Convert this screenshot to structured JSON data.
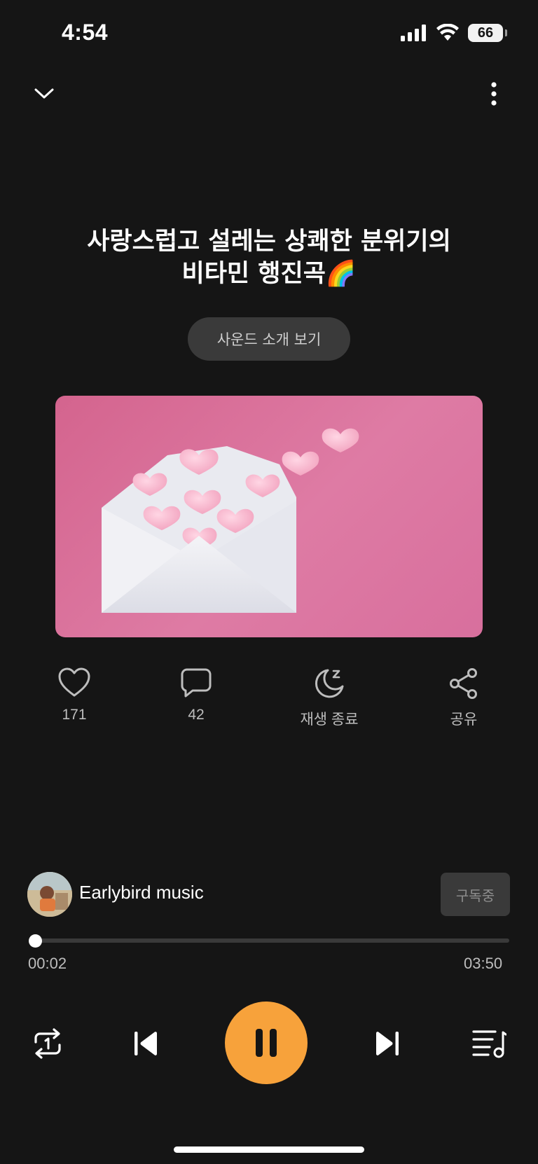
{
  "status_bar": {
    "time": "4:54",
    "battery": "66"
  },
  "header": {
    "collapse_icon": "chevron-down-icon",
    "more_icon": "more-vertical-icon"
  },
  "track": {
    "title_line1": "사랑스럽고 설레는 상쾌한 분위기의",
    "title_line2": "비타민 행진곡🌈",
    "intro_button": "사운드 소개 보기"
  },
  "actions": {
    "like_count": "171",
    "comment_count": "42",
    "sleep_timer_label": "재생 종료",
    "share_label": "공유"
  },
  "channel": {
    "name": "Earlybird music",
    "subscribe_label": "구독중"
  },
  "playback": {
    "elapsed": "00:02",
    "duration": "03:50",
    "progress_fraction": 0.009
  },
  "colors": {
    "background": "#151515",
    "accent": "#f7a23b",
    "artwork_pink": "#d86f9d"
  }
}
